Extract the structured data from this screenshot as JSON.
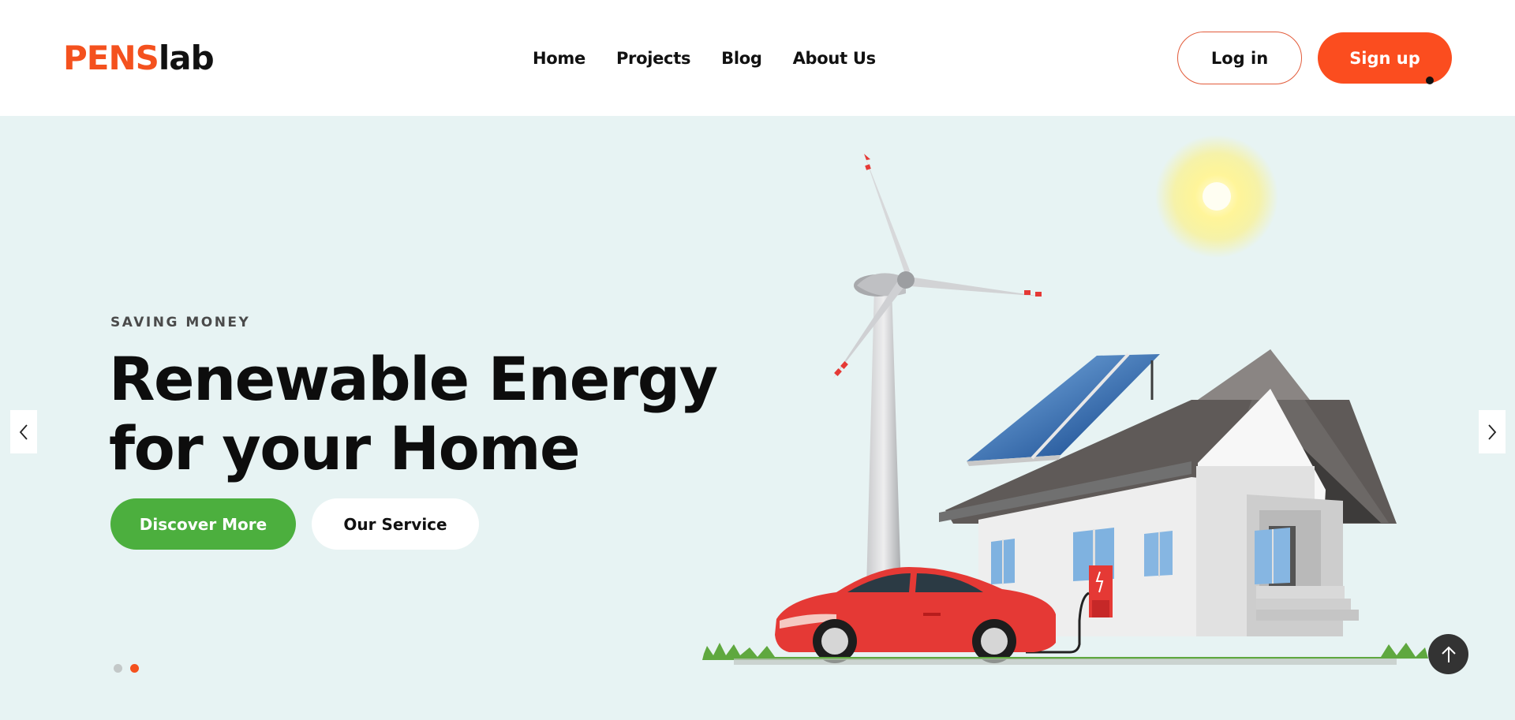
{
  "header": {
    "logo": {
      "part1": "PENS",
      "part2": "lab"
    },
    "nav": [
      "Home",
      "Projects",
      "Blog",
      "About Us"
    ],
    "login_label": "Log in",
    "signup_label": "Sign up"
  },
  "hero": {
    "eyebrow": "SAVING MONEY",
    "headline": "Renewable Energy for your Home",
    "primary_cta": "Discover More",
    "secondary_cta": "Our Service",
    "slides": {
      "count": 2,
      "active": 2
    }
  },
  "icons": {
    "prev": "chevron-left-icon",
    "next": "chevron-right-icon",
    "back_to_top": "arrow-up-icon"
  },
  "colors": {
    "brand": "#f4511e",
    "signup": "#fb4d1f",
    "green_cta": "#4caf3e",
    "hero_bg": "#e7f3f3",
    "dot_active": "#f4511e",
    "dot_inactive": "#c3c8c8"
  }
}
